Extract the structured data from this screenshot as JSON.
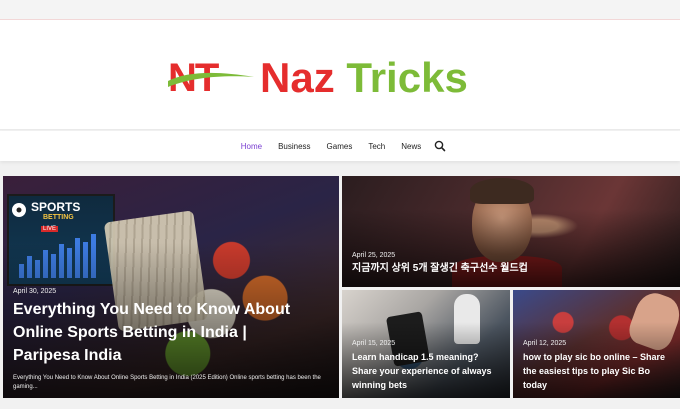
{
  "site": {
    "logo_mark": "NT",
    "logo_word_1": "Naz",
    "logo_word_2": "Tricks"
  },
  "nav": {
    "items": [
      {
        "label": "Home",
        "active": true
      },
      {
        "label": "Business",
        "active": false
      },
      {
        "label": "Games",
        "active": false
      },
      {
        "label": "Tech",
        "active": false
      },
      {
        "label": "News",
        "active": false
      }
    ],
    "search_icon": "search-icon"
  },
  "posts": [
    {
      "date": "April 30, 2025",
      "title": "Everything You Need to Know About Online Sports Betting in India | Paripesa India",
      "excerpt": "Everything You Need to Know About Online Sports Betting in India (2025 Edition) Online sports betting has been the gaming...",
      "image_text_1": "SPORTS",
      "image_text_2": "BETTING",
      "image_text_3": "LIVE"
    },
    {
      "date": "April 25, 2025",
      "title": "지금까지 상위 5개 잘생긴 축구선수 월드컵"
    },
    {
      "date": "April 15, 2025",
      "title": "Learn handicap 1.5 meaning? Share your experience of always winning bets"
    },
    {
      "date": "April 12, 2025",
      "title": "how to play sic bo online – Share the easiest tips to play Sic Bo today"
    }
  ],
  "colors": {
    "brand_red": "#e52d2d",
    "brand_green": "#7dbb38",
    "nav_active": "#7a3fd1"
  }
}
